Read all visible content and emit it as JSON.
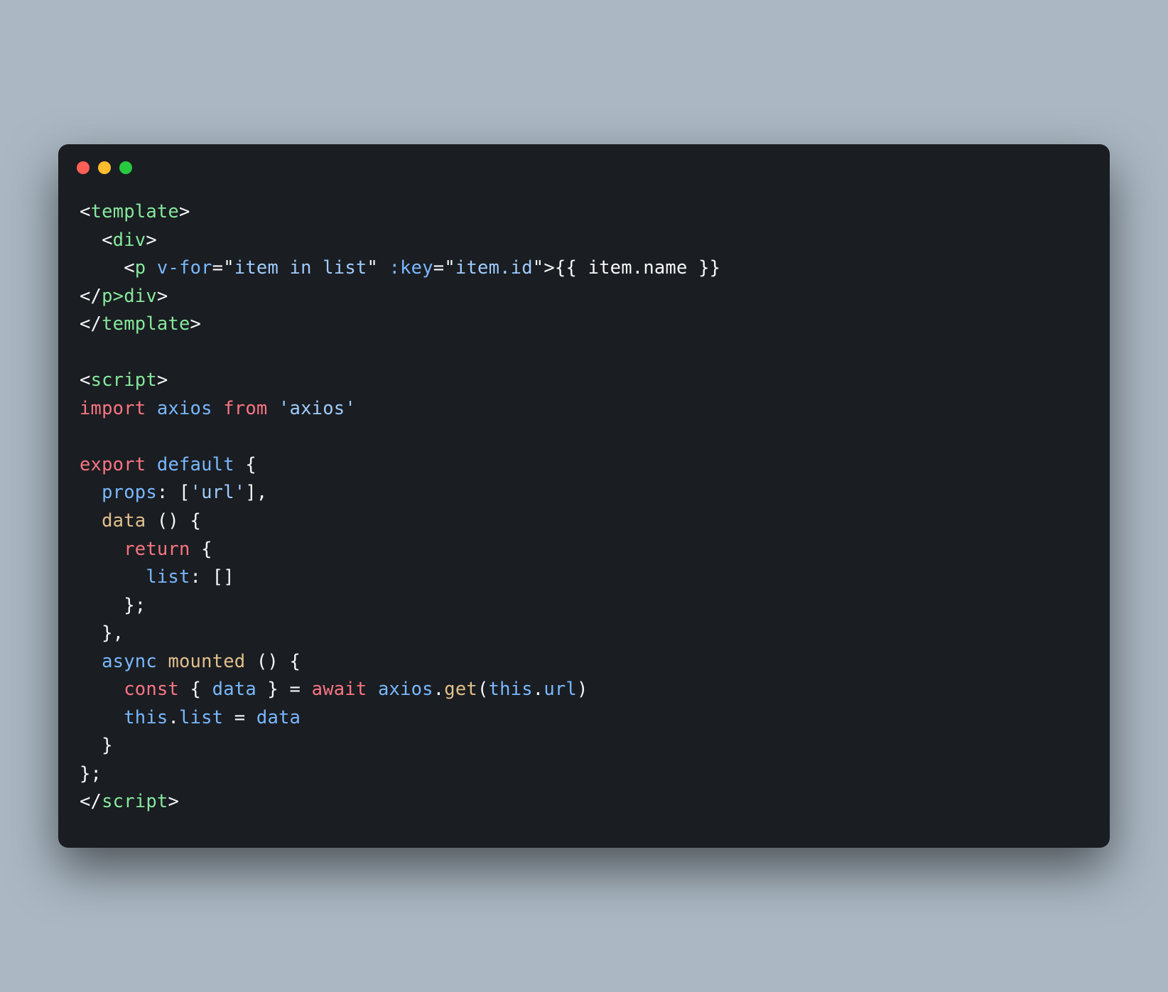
{
  "window": {
    "traffic_lights": [
      "close",
      "minimize",
      "zoom"
    ]
  },
  "code": {
    "lines": [
      [
        {
          "t": "<",
          "c": "punct"
        },
        {
          "t": "template",
          "c": "tag"
        },
        {
          "t": ">",
          "c": "punct"
        }
      ],
      [
        {
          "t": "  ",
          "c": "plain"
        },
        {
          "t": "<",
          "c": "punct"
        },
        {
          "t": "div",
          "c": "tag"
        },
        {
          "t": ">",
          "c": "punct"
        }
      ],
      [
        {
          "t": "    ",
          "c": "plain"
        },
        {
          "t": "<",
          "c": "punct"
        },
        {
          "t": "p",
          "c": "tag"
        },
        {
          "t": " ",
          "c": "plain"
        },
        {
          "t": "v-for",
          "c": "attr"
        },
        {
          "t": "=",
          "c": "punct"
        },
        {
          "t": "\"",
          "c": "punct"
        },
        {
          "t": "item in list",
          "c": "str"
        },
        {
          "t": "\"",
          "c": "punct"
        },
        {
          "t": " ",
          "c": "plain"
        },
        {
          "t": ":key",
          "c": "attr"
        },
        {
          "t": "=",
          "c": "punct"
        },
        {
          "t": "\"",
          "c": "punct"
        },
        {
          "t": "item.id",
          "c": "str"
        },
        {
          "t": "\"",
          "c": "punct"
        },
        {
          "t": ">",
          "c": "punct"
        },
        {
          "t": "{{ item.name }}",
          "c": "txt"
        }
      ],
      [
        {
          "t": "</",
          "c": "punct"
        },
        {
          "t": "p>",
          "c": "tag"
        },
        {
          "t": "div",
          "c": "tag"
        },
        {
          "t": ">",
          "c": "punct"
        }
      ],
      [
        {
          "t": "</",
          "c": "punct"
        },
        {
          "t": "template",
          "c": "tag"
        },
        {
          "t": ">",
          "c": "punct"
        }
      ],
      [
        {
          "t": "",
          "c": "plain"
        }
      ],
      [
        {
          "t": "<",
          "c": "punct"
        },
        {
          "t": "script",
          "c": "tag"
        },
        {
          "t": ">",
          "c": "punct"
        }
      ],
      [
        {
          "t": "import",
          "c": "kw"
        },
        {
          "t": " ",
          "c": "plain"
        },
        {
          "t": "axios",
          "c": "obj"
        },
        {
          "t": " ",
          "c": "plain"
        },
        {
          "t": "from",
          "c": "kw"
        },
        {
          "t": " ",
          "c": "plain"
        },
        {
          "t": "'axios'",
          "c": "str"
        }
      ],
      [
        {
          "t": "",
          "c": "plain"
        }
      ],
      [
        {
          "t": "export",
          "c": "kw"
        },
        {
          "t": " ",
          "c": "plain"
        },
        {
          "t": "default",
          "c": "kw2"
        },
        {
          "t": " {",
          "c": "punct"
        }
      ],
      [
        {
          "t": "  ",
          "c": "plain"
        },
        {
          "t": "props",
          "c": "obj"
        },
        {
          "t": ": [",
          "c": "punct"
        },
        {
          "t": "'url'",
          "c": "str"
        },
        {
          "t": "],",
          "c": "punct"
        }
      ],
      [
        {
          "t": "  ",
          "c": "plain"
        },
        {
          "t": "data",
          "c": "fn"
        },
        {
          "t": " () {",
          "c": "punct"
        }
      ],
      [
        {
          "t": "    ",
          "c": "plain"
        },
        {
          "t": "return",
          "c": "kw"
        },
        {
          "t": " {",
          "c": "punct"
        }
      ],
      [
        {
          "t": "      ",
          "c": "plain"
        },
        {
          "t": "list",
          "c": "obj"
        },
        {
          "t": ": []",
          "c": "punct"
        }
      ],
      [
        {
          "t": "    };",
          "c": "punct"
        }
      ],
      [
        {
          "t": "  },",
          "c": "punct"
        }
      ],
      [
        {
          "t": "  ",
          "c": "plain"
        },
        {
          "t": "async",
          "c": "kw2"
        },
        {
          "t": " ",
          "c": "plain"
        },
        {
          "t": "mounted",
          "c": "fn"
        },
        {
          "t": " () {",
          "c": "punct"
        }
      ],
      [
        {
          "t": "    ",
          "c": "plain"
        },
        {
          "t": "const",
          "c": "kw"
        },
        {
          "t": " { ",
          "c": "punct"
        },
        {
          "t": "data",
          "c": "obj"
        },
        {
          "t": " } = ",
          "c": "punct"
        },
        {
          "t": "await",
          "c": "kw"
        },
        {
          "t": " ",
          "c": "plain"
        },
        {
          "t": "axios",
          "c": "obj"
        },
        {
          "t": ".",
          "c": "punct"
        },
        {
          "t": "get",
          "c": "fn"
        },
        {
          "t": "(",
          "c": "punct"
        },
        {
          "t": "this",
          "c": "kw2"
        },
        {
          "t": ".",
          "c": "punct"
        },
        {
          "t": "url",
          "c": "obj"
        },
        {
          "t": ")",
          "c": "punct"
        }
      ],
      [
        {
          "t": "    ",
          "c": "plain"
        },
        {
          "t": "this",
          "c": "kw2"
        },
        {
          "t": ".",
          "c": "punct"
        },
        {
          "t": "list",
          "c": "obj"
        },
        {
          "t": " = ",
          "c": "punct"
        },
        {
          "t": "data",
          "c": "obj"
        }
      ],
      [
        {
          "t": "  }",
          "c": "punct"
        }
      ],
      [
        {
          "t": "};",
          "c": "punct"
        }
      ],
      [
        {
          "t": "</",
          "c": "punct"
        },
        {
          "t": "script",
          "c": "tag"
        },
        {
          "t": ">",
          "c": "punct"
        }
      ]
    ]
  }
}
